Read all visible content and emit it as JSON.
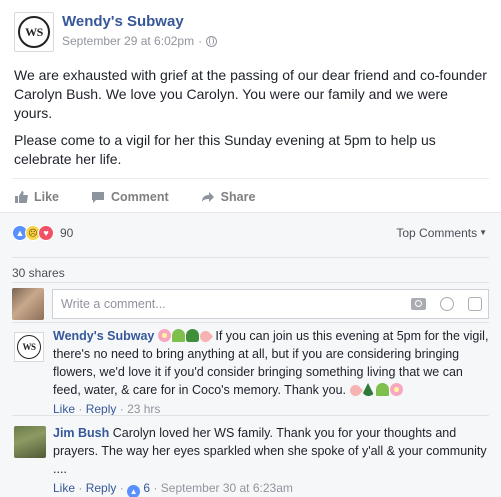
{
  "post": {
    "page_name": "Wendy's Subway",
    "logo_text": "WS",
    "timestamp": "September 29 at 6:02pm",
    "meta_sep": "·",
    "paragraphs": [
      "We are exhausted with grief at the passing of our dear friend and co-founder Carolyn Bush. We love you Carolyn. You were our family and we were yours.",
      "Please come to a vigil for her this Sunday evening at 5pm to help us celebrate her life."
    ],
    "more_icon": "more-dots-icon"
  },
  "actions": {
    "like": "Like",
    "comment": "Comment",
    "share": "Share"
  },
  "reactions": {
    "icons": [
      "like-icon",
      "sad-icon",
      "love-icon"
    ],
    "count": "90",
    "sort_label": "Top Comments"
  },
  "shares": "30 shares",
  "composer": {
    "placeholder": "Write a comment..."
  },
  "comments": [
    {
      "author": "Wendy's Subway",
      "text": " If you can join us this evening at 5pm for the vigil, there's no need to bring anything at all, but if you are considering bringing flowers, we'd love it if you'd consider bringing something living that we can feed, water, & care for in Coco's memory. Thank you. ",
      "like_label": "Like",
      "reply_label": "Reply",
      "time": "23 hrs"
    },
    {
      "author": "Jim Bush",
      "text": " Carolyn loved her WS family. Thank you for your thoughts and prayers. The way her eyes sparkled when she spoke of y'all & your community ....",
      "like_label": "Like",
      "reply_label": "Reply",
      "like_count": "6",
      "time": "September 30 at 6:23am"
    }
  ],
  "colors": {
    "link_blue": "#365899",
    "meta_gray": "#90949c",
    "like_blue": "#5890ff",
    "love_red": "#f25268"
  }
}
